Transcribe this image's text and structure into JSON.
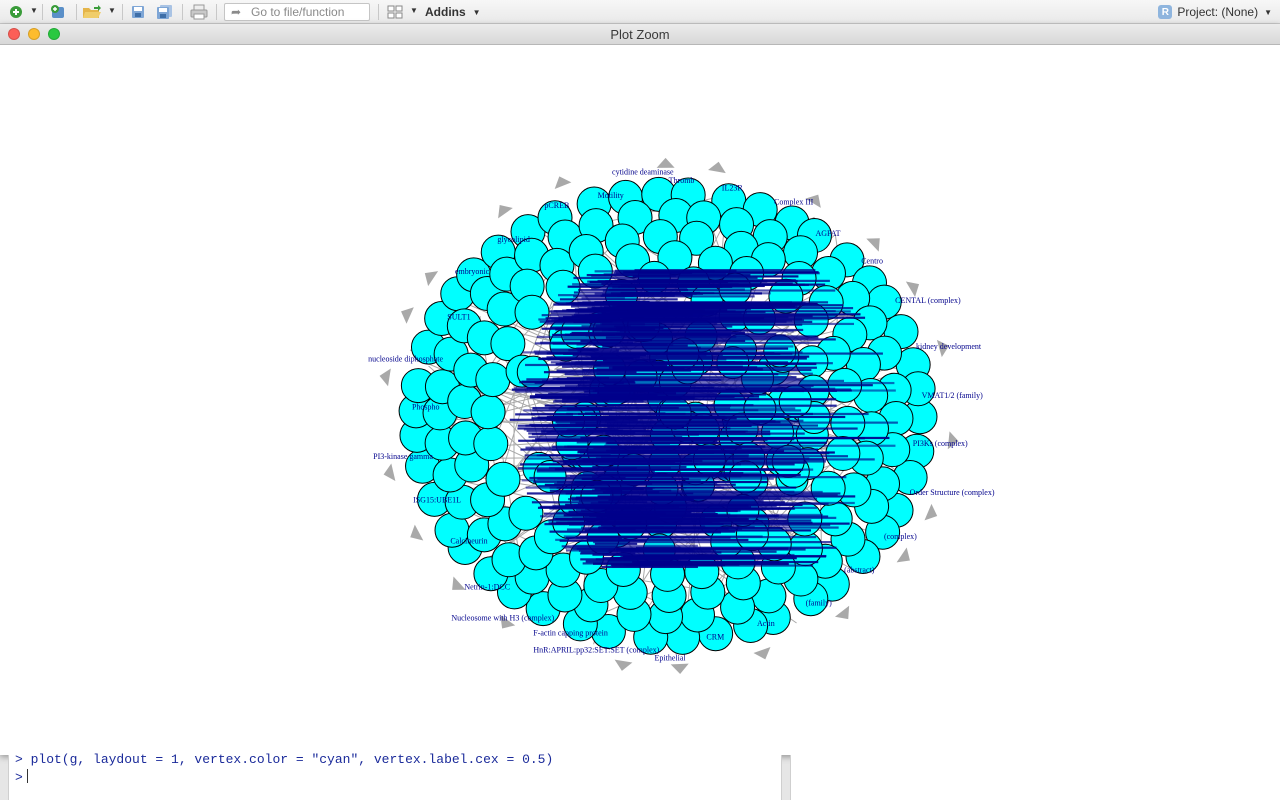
{
  "toolbar": {
    "goto_placeholder": "Go to file/function",
    "addins_label": "Addins",
    "project_label": "Project: (None)",
    "project_icon_letter": "R"
  },
  "window": {
    "title": "Plot Zoom",
    "traffic_lights": {
      "close": "#fc5f57",
      "minimize": "#fdbc2e",
      "zoom": "#2ac840"
    }
  },
  "plot": {
    "vertex_color": "#00ffff",
    "label_color": "#00008b",
    "edge_color": "#a9a9a9",
    "readable_labels": [
      "HnR:APRIL:pp32:SET:SET (complex)",
      "F-actin capping protein",
      "Nucleosome with H3 (complex)",
      "Netrin-1:DCC",
      "Calcineurin",
      "ISG15:UBE1L",
      "PI3-kinase gamma",
      "Phospho",
      "nucleoside diphosphate",
      "SULT1",
      "embryonic",
      "glycolipid",
      "pCREB",
      "Motility",
      "cytidine deaminase",
      "Thromb",
      "IL23R",
      "Complex III",
      "AGPAT",
      "Centro",
      "CENTAL (complex)",
      "kidney development",
      "VMAT1/2 (family)",
      "PI3Ks (complex)",
      "Order Structure (complex)",
      "(complex)",
      "(abstract)",
      "(family)",
      "Actin",
      "CRM",
      "Epithelial"
    ]
  },
  "console": {
    "command_line": "> plot(g, laydout = 1, vertex.color = \"cyan\", vertex.label.cex = 0.5)",
    "prompt": ">"
  }
}
